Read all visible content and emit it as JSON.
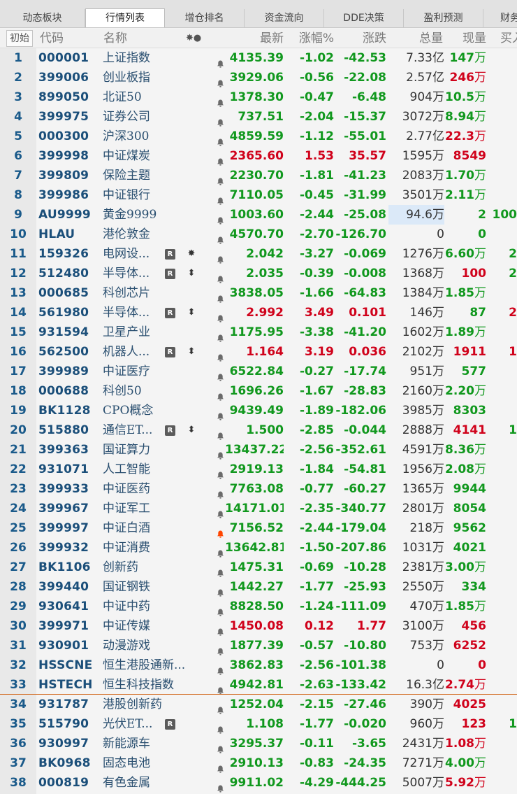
{
  "tabs": [
    "动态板块",
    "行情列表",
    "增仓排名",
    "资金流向",
    "DDE决策",
    "盈利预测",
    "财务"
  ],
  "active_tab": 1,
  "header": {
    "init": "初始",
    "code": "代码",
    "name": "名称",
    "flags": "✸●",
    "price": "最新",
    "pct": "涨幅%",
    "chg": "涨跌",
    "vol": "总量",
    "cur": "现量",
    "bid": "买入"
  },
  "colors": {
    "up": "#d0021b",
    "down": "#11981e",
    "separator": "#d2691e"
  },
  "rows": [
    {
      "idx": "1",
      "code": "000001",
      "name": "上证指数",
      "price": "4135.39",
      "pct": "-1.02",
      "chg": "-42.53",
      "vol": "7.33",
      "vol_unit": "亿",
      "cur": "147",
      "cur_unit": "万",
      "cur_dir": "dn",
      "bid": ""
    },
    {
      "idx": "2",
      "code": "399006",
      "name": "创业板指",
      "price": "3929.06",
      "pct": "-0.56",
      "chg": "-22.08",
      "vol": "2.57",
      "vol_unit": "亿",
      "cur": "246",
      "cur_unit": "万",
      "cur_dir": "up",
      "bid": ""
    },
    {
      "idx": "3",
      "code": "899050",
      "name": "北证50",
      "price": "1378.30",
      "pct": "-0.47",
      "chg": "-6.48",
      "vol": "904",
      "vol_unit": "万",
      "cur": "10.5",
      "cur_unit": "万",
      "cur_dir": "dn",
      "bid": ""
    },
    {
      "idx": "4",
      "code": "399975",
      "name": "证券公司",
      "price": "737.51",
      "pct": "-2.04",
      "chg": "-15.37",
      "vol": "3072",
      "vol_unit": "万",
      "cur": "8.94",
      "cur_unit": "万",
      "cur_dir": "dn",
      "bid": ""
    },
    {
      "idx": "5",
      "code": "000300",
      "name": "沪深300",
      "price": "4859.59",
      "pct": "-1.12",
      "chg": "-55.01",
      "vol": "2.77",
      "vol_unit": "亿",
      "cur": "22.3",
      "cur_unit": "万",
      "cur_dir": "up",
      "bid": ""
    },
    {
      "idx": "6",
      "code": "399998",
      "name": "中证煤炭",
      "price": "2365.60",
      "pct": "1.53",
      "chg": "35.57",
      "vol": "1595",
      "vol_unit": "万",
      "cur": "8549",
      "cur_unit": "",
      "cur_dir": "up",
      "bid": ""
    },
    {
      "idx": "7",
      "code": "399809",
      "name": "保险主题",
      "price": "2230.70",
      "pct": "-1.81",
      "chg": "-41.23",
      "vol": "2083",
      "vol_unit": "万",
      "cur": "1.70",
      "cur_unit": "万",
      "cur_dir": "dn",
      "bid": ""
    },
    {
      "idx": "8",
      "code": "399986",
      "name": "中证银行",
      "price": "7110.05",
      "pct": "-0.45",
      "chg": "-31.99",
      "vol": "3501",
      "vol_unit": "万",
      "cur": "2.11",
      "cur_unit": "万",
      "cur_dir": "dn",
      "bid": ""
    },
    {
      "idx": "9",
      "code": "AU9999",
      "name": "黄金9999",
      "price": "1003.60",
      "pct": "-2.44",
      "chg": "-25.08",
      "vol": "94.6",
      "vol_unit": "万",
      "cur": "2",
      "cur_unit": "",
      "cur_dir": "dn",
      "bid": "100",
      "bid_dir": "dn",
      "highlight": true
    },
    {
      "idx": "10",
      "code": "HLAU",
      "name": "港伦敦金",
      "price": "4570.70",
      "pct": "-2.70",
      "chg": "-126.70",
      "vol": "0",
      "vol_unit": "",
      "cur": "0",
      "cur_unit": "",
      "cur_dir": "dn",
      "bid": ""
    },
    {
      "idx": "11",
      "code": "159326",
      "name": "电网设...",
      "badge": "R",
      "flag": "✸",
      "price": "2.042",
      "pct": "-3.27",
      "chg": "-0.069",
      "vol": "1276",
      "vol_unit": "万",
      "cur": "6.60",
      "cur_unit": "万",
      "cur_dir": "dn",
      "bid": "2",
      "bid_dir": "dn"
    },
    {
      "idx": "12",
      "code": "512480",
      "name": "半导体...",
      "badge": "R",
      "flag": "⬍",
      "price": "2.035",
      "pct": "-0.39",
      "chg": "-0.008",
      "vol": "1368",
      "vol_unit": "万",
      "cur": "100",
      "cur_unit": "",
      "cur_dir": "up",
      "bid": "2",
      "bid_dir": "dn"
    },
    {
      "idx": "13",
      "code": "000685",
      "name": "科创芯片",
      "price": "3838.05",
      "pct": "-1.66",
      "chg": "-64.83",
      "vol": "1384",
      "vol_unit": "万",
      "cur": "1.85",
      "cur_unit": "万",
      "cur_dir": "dn",
      "bid": ""
    },
    {
      "idx": "14",
      "code": "561980",
      "name": "半导体...",
      "badge": "R",
      "flag": "⬍",
      "price": "2.992",
      "pct": "3.49",
      "chg": "0.101",
      "vol": "146",
      "vol_unit": "万",
      "cur": "87",
      "cur_unit": "",
      "cur_dir": "dn",
      "bid": "2",
      "bid_dir": "up"
    },
    {
      "idx": "15",
      "code": "931594",
      "name": "卫星产业",
      "price": "1175.95",
      "pct": "-3.38",
      "chg": "-41.20",
      "vol": "1602",
      "vol_unit": "万",
      "cur": "1.89",
      "cur_unit": "万",
      "cur_dir": "dn",
      "bid": ""
    },
    {
      "idx": "16",
      "code": "562500",
      "name": "机器人...",
      "badge": "R",
      "flag": "⬍",
      "price": "1.164",
      "pct": "3.19",
      "chg": "0.036",
      "vol": "2102",
      "vol_unit": "万",
      "cur": "1911",
      "cur_unit": "",
      "cur_dir": "up",
      "bid": "1",
      "bid_dir": "up"
    },
    {
      "idx": "17",
      "code": "399989",
      "name": "中证医疗",
      "price": "6522.84",
      "pct": "-0.27",
      "chg": "-17.74",
      "vol": "951",
      "vol_unit": "万",
      "cur": "577",
      "cur_unit": "",
      "cur_dir": "dn",
      "bid": ""
    },
    {
      "idx": "18",
      "code": "000688",
      "name": "科创50",
      "price": "1696.26",
      "pct": "-1.67",
      "chg": "-28.83",
      "vol": "2160",
      "vol_unit": "万",
      "cur": "2.20",
      "cur_unit": "万",
      "cur_dir": "dn",
      "bid": ""
    },
    {
      "idx": "19",
      "code": "BK1128",
      "name": "CPO概念",
      "price": "9439.49",
      "pct": "-1.89",
      "chg": "-182.06",
      "vol": "3985",
      "vol_unit": "万",
      "cur": "8303",
      "cur_unit": "",
      "cur_dir": "dn",
      "bid": ""
    },
    {
      "idx": "20",
      "code": "515880",
      "name": "通信ET...",
      "badge": "R",
      "flag": "⬍",
      "price": "1.500",
      "pct": "-2.85",
      "chg": "-0.044",
      "vol": "2888",
      "vol_unit": "万",
      "cur": "4141",
      "cur_unit": "",
      "cur_dir": "up",
      "bid": "1",
      "bid_dir": "dn"
    },
    {
      "idx": "21",
      "code": "399363",
      "name": "国证算力",
      "price": "13437.22",
      "pct": "-2.56",
      "chg": "-352.61",
      "vol": "4591",
      "vol_unit": "万",
      "cur": "8.36",
      "cur_unit": "万",
      "cur_dir": "dn",
      "bid": ""
    },
    {
      "idx": "22",
      "code": "931071",
      "name": "人工智能",
      "price": "2919.13",
      "pct": "-1.84",
      "chg": "-54.81",
      "vol": "1956",
      "vol_unit": "万",
      "cur": "2.08",
      "cur_unit": "万",
      "cur_dir": "dn",
      "bid": ""
    },
    {
      "idx": "23",
      "code": "399933",
      "name": "中证医药",
      "price": "7763.08",
      "pct": "-0.77",
      "chg": "-60.27",
      "vol": "1365",
      "vol_unit": "万",
      "cur": "9944",
      "cur_unit": "",
      "cur_dir": "dn",
      "bid": ""
    },
    {
      "idx": "24",
      "code": "399967",
      "name": "中证军工",
      "price": "14171.01",
      "pct": "-2.35",
      "chg": "-340.77",
      "vol": "2801",
      "vol_unit": "万",
      "cur": "8054",
      "cur_unit": "",
      "cur_dir": "dn",
      "bid": ""
    },
    {
      "idx": "25",
      "code": "399997",
      "name": "中证白酒",
      "bell_active": true,
      "price": "7156.52",
      "pct": "-2.44",
      "chg": "-179.04",
      "vol": "218",
      "vol_unit": "万",
      "cur": "9562",
      "cur_unit": "",
      "cur_dir": "dn",
      "bid": ""
    },
    {
      "idx": "26",
      "code": "399932",
      "name": "中证消费",
      "price": "13642.81",
      "pct": "-1.50",
      "chg": "-207.86",
      "vol": "1031",
      "vol_unit": "万",
      "cur": "4021",
      "cur_unit": "",
      "cur_dir": "dn",
      "bid": ""
    },
    {
      "idx": "27",
      "code": "BK1106",
      "name": "创新药",
      "price": "1475.31",
      "pct": "-0.69",
      "chg": "-10.28",
      "vol": "2381",
      "vol_unit": "万",
      "cur": "3.00",
      "cur_unit": "万",
      "cur_dir": "dn",
      "bid": ""
    },
    {
      "idx": "28",
      "code": "399440",
      "name": "国证钢铁",
      "price": "1442.27",
      "pct": "-1.77",
      "chg": "-25.93",
      "vol": "2550",
      "vol_unit": "万",
      "cur": "334",
      "cur_unit": "",
      "cur_dir": "dn",
      "bid": ""
    },
    {
      "idx": "29",
      "code": "930641",
      "name": "中证中药",
      "price": "8828.50",
      "pct": "-1.24",
      "chg": "-111.09",
      "vol": "470",
      "vol_unit": "万",
      "cur": "1.85",
      "cur_unit": "万",
      "cur_dir": "dn",
      "bid": ""
    },
    {
      "idx": "30",
      "code": "399971",
      "name": "中证传媒",
      "price": "1450.08",
      "pct": "0.12",
      "chg": "1.77",
      "vol": "3100",
      "vol_unit": "万",
      "cur": "456",
      "cur_unit": "",
      "cur_dir": "up",
      "bid": ""
    },
    {
      "idx": "31",
      "code": "930901",
      "name": "动漫游戏",
      "price": "1877.39",
      "pct": "-0.57",
      "chg": "-10.80",
      "vol": "753",
      "vol_unit": "万",
      "cur": "6252",
      "cur_unit": "",
      "cur_dir": "up",
      "bid": ""
    },
    {
      "idx": "32",
      "code": "HSSCNE",
      "name": "恒生港股通新...",
      "price": "3862.83",
      "pct": "-2.56",
      "chg": "-101.38",
      "vol": "0",
      "vol_unit": "",
      "cur": "0",
      "cur_unit": "",
      "cur_dir": "up",
      "bid": ""
    },
    {
      "idx": "33",
      "code": "HSTECH",
      "name": "恒生科技指数",
      "price": "4942.81",
      "pct": "-2.63",
      "chg": "-133.42",
      "vol": "16.3",
      "vol_unit": "亿",
      "cur": "2.74",
      "cur_unit": "万",
      "cur_dir": "up",
      "bid": ""
    },
    {
      "idx": "34",
      "code": "931787",
      "name": "港股创新药",
      "price": "1252.04",
      "pct": "-2.15",
      "chg": "-27.46",
      "vol": "390",
      "vol_unit": "万",
      "cur": "4025",
      "cur_unit": "",
      "cur_dir": "up",
      "bid": ""
    },
    {
      "idx": "35",
      "code": "515790",
      "name": "光伏ET...",
      "badge": "R",
      "price": "1.108",
      "pct": "-1.77",
      "chg": "-0.020",
      "vol": "960",
      "vol_unit": "万",
      "cur": "123",
      "cur_unit": "",
      "cur_dir": "up",
      "bid": "1",
      "bid_dir": "dn"
    },
    {
      "idx": "36",
      "code": "930997",
      "name": "新能源车",
      "price": "3295.37",
      "pct": "-0.11",
      "chg": "-3.65",
      "vol": "2431",
      "vol_unit": "万",
      "cur": "1.08",
      "cur_unit": "万",
      "cur_dir": "up",
      "bid": ""
    },
    {
      "idx": "37",
      "code": "BK0968",
      "name": "固态电池",
      "price": "2910.13",
      "pct": "-0.83",
      "chg": "-24.35",
      "vol": "7271",
      "vol_unit": "万",
      "cur": "4.00",
      "cur_unit": "万",
      "cur_dir": "dn",
      "bid": ""
    },
    {
      "idx": "38",
      "code": "000819",
      "name": "有色金属",
      "price": "9911.02",
      "pct": "-4.29",
      "chg": "-444.25",
      "vol": "5007",
      "vol_unit": "万",
      "cur": "5.92",
      "cur_unit": "万",
      "cur_dir": "up",
      "bid": ""
    }
  ]
}
